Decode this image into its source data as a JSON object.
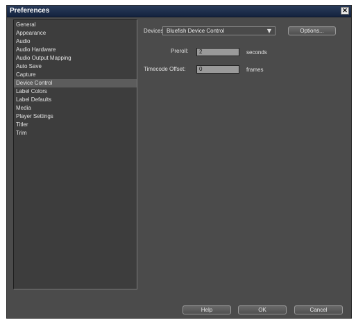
{
  "window": {
    "title": "Preferences",
    "close_glyph": "✕"
  },
  "sidebar": {
    "items": [
      {
        "label": "General"
      },
      {
        "label": "Appearance"
      },
      {
        "label": "Audio"
      },
      {
        "label": "Audio Hardware"
      },
      {
        "label": "Audio Output Mapping"
      },
      {
        "label": "Auto Save"
      },
      {
        "label": "Capture"
      },
      {
        "label": "Device Control"
      },
      {
        "label": "Label Colors"
      },
      {
        "label": "Label Defaults"
      },
      {
        "label": "Media"
      },
      {
        "label": "Player Settings"
      },
      {
        "label": "Titler"
      },
      {
        "label": "Trim"
      }
    ],
    "selected": "Device Control"
  },
  "device_control": {
    "devices_label": "Devices:",
    "devices_value": "Bluefish Device Control",
    "options_label": "Options...",
    "preroll_label": "Preroll:",
    "preroll_value": "2",
    "preroll_unit": "seconds",
    "timecode_offset_label": "Timecode Offset:",
    "timecode_offset_value": "0",
    "timecode_offset_unit": "frames"
  },
  "footer": {
    "help_label": "Help",
    "ok_label": "OK",
    "cancel_label": "Cancel"
  },
  "colors": {
    "panel": "#4b4b4b",
    "title_bar": "#1a2a47",
    "selected_row": "#5c5c5c"
  }
}
